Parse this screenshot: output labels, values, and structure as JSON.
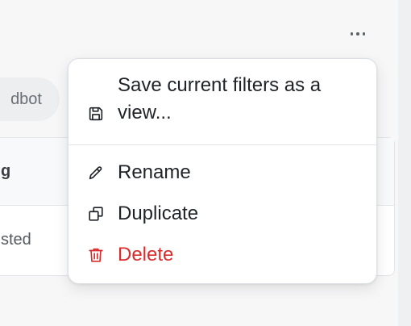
{
  "toolbar": {
    "more_icon": "more-horizontal-icon"
  },
  "filters": {
    "chip_label": "dbot"
  },
  "table": {
    "header_cell": "g",
    "row_cell": "sted"
  },
  "menu": {
    "items": [
      {
        "label": "Save current filters as a view...",
        "icon": "save-icon"
      },
      {
        "label": "Rename",
        "icon": "pencil-icon"
      },
      {
        "label": "Duplicate",
        "icon": "duplicate-icon"
      },
      {
        "label": "Delete",
        "icon": "trash-icon"
      }
    ]
  },
  "colors": {
    "danger": "#d92c2c",
    "text": "#1f2328",
    "icon": "#1f2328"
  }
}
